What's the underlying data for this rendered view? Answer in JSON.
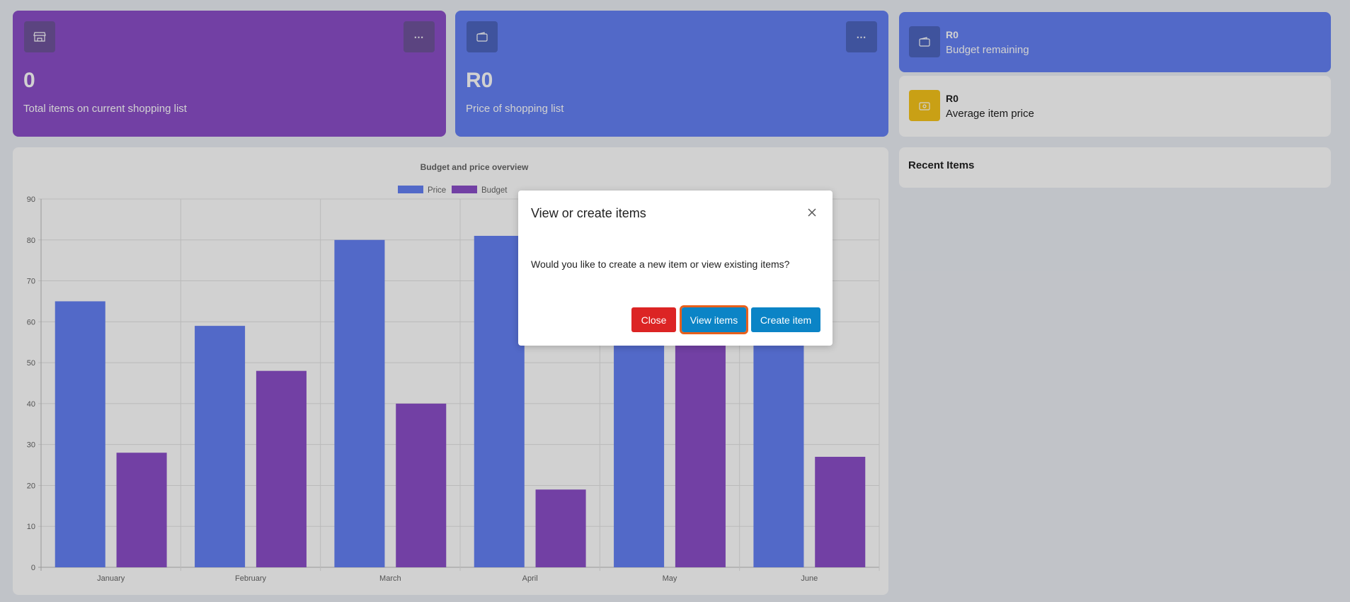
{
  "cards": {
    "items": {
      "value": "0",
      "label": "Total items on current shopping list",
      "icon": "store-icon",
      "menu": "⋯"
    },
    "price": {
      "value": "R0",
      "label": "Price of shopping list",
      "icon": "wallet-icon",
      "menu": "⋯"
    },
    "budget": {
      "value": "R0",
      "label": "Budget remaining",
      "icon": "wallet-icon"
    },
    "avg": {
      "value": "R0",
      "label": "Average item price",
      "icon": "money-icon"
    }
  },
  "recent": {
    "title": "Recent Items"
  },
  "colors": {
    "price": "#6580f4",
    "budget": "#8b4fc9",
    "accent": "#0b84c6",
    "danger": "#dc2424"
  },
  "chart_data": {
    "type": "bar",
    "title": "Budget and price overview",
    "categories": [
      "January",
      "February",
      "March",
      "April",
      "May",
      "June"
    ],
    "series": [
      {
        "name": "Price",
        "values": [
          65,
          59,
          80,
          81,
          56,
          55
        ]
      },
      {
        "name": "Budget",
        "values": [
          28,
          48,
          40,
          19,
          86,
          27
        ]
      }
    ],
    "ylim": [
      0,
      90
    ],
    "yticks": [
      0,
      10,
      20,
      30,
      40,
      50,
      60,
      70,
      80,
      90
    ],
    "grid": true,
    "legend": "top-center"
  },
  "dialog": {
    "title": "View or create items",
    "body": "Would you like to create a new item or view existing items?",
    "close_label": "Close",
    "view_label": "View items",
    "create_label": "Create item"
  }
}
